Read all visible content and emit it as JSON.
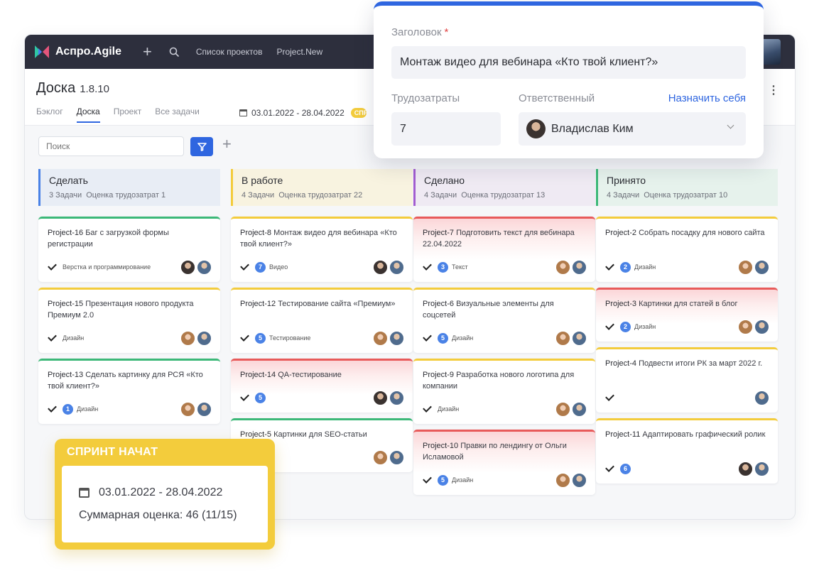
{
  "app": {
    "logo": "Аспро.Agile",
    "nav": [
      "Список проектов",
      "Project.New"
    ]
  },
  "header": {
    "title": "Доска",
    "version": "1.8.10",
    "tabs": [
      "Бэклог",
      "Доска",
      "Проект",
      "Все задачи"
    ],
    "active_tab": "Доска",
    "date_range": "03.01.2022 - 28.04.2022",
    "sprint_chip": "СПРИНТ НАЧАТ"
  },
  "toolbar": {
    "search_placeholder": "Поиск"
  },
  "columns": [
    {
      "title": "Сделать",
      "count": "3 Задачи",
      "estimate": "Оценка трудозатрат 1",
      "color": "#4a82e6",
      "bg": "#e8edf5",
      "cards": [
        {
          "id": "Project-16",
          "title": "Баг с загрузкой формы регистрации",
          "estimate": "",
          "tag": "Верстка и программирование",
          "accent": "#3cb878",
          "urgent": false,
          "avatars": [
            "man1",
            "man2"
          ]
        },
        {
          "id": "Project-15",
          "title": "Презентация нового продукта Премиум 2.0",
          "estimate": "",
          "tag": "Дизайн",
          "accent": "#f3cc3c",
          "urgent": false,
          "avatars": [
            "woman",
            "man2"
          ]
        },
        {
          "id": "Project-13",
          "title": "Сделать картинку для РСЯ «Кто твой клиент?»",
          "estimate": "1",
          "tag": "Дизайн",
          "accent": "#3cb878",
          "urgent": false,
          "avatars": [
            "woman",
            "man2"
          ]
        }
      ]
    },
    {
      "title": "В работе",
      "count": "4 Задачи",
      "estimate": "Оценка трудозатрат 22",
      "color": "#f3cc3c",
      "bg": "#f8f3e0",
      "cards": [
        {
          "id": "Project-8",
          "title": "Монтаж видео для вебинара «Кто твой клиент?»",
          "estimate": "7",
          "tag": "Видео",
          "accent": "#f3cc3c",
          "urgent": false,
          "avatars": [
            "man1",
            "man2"
          ]
        },
        {
          "id": "Project-12",
          "title": "Тестирование сайта «Премиум»",
          "estimate": "5",
          "tag": "Тестирование",
          "accent": "#f3cc3c",
          "urgent": false,
          "avatars": [
            "woman",
            "man2"
          ]
        },
        {
          "id": "Project-14",
          "title": "QA-тестирование",
          "estimate": "5",
          "tag": "",
          "accent": "#e85a5a",
          "urgent": true,
          "avatars": [
            "man1",
            "man2"
          ]
        },
        {
          "id": "Project-5",
          "title": "Картинки для SEO-статьи",
          "estimate": "",
          "tag": "",
          "accent": "#3cb878",
          "urgent": false,
          "avatars": [
            "woman",
            "man2"
          ]
        }
      ]
    },
    {
      "title": "Сделано",
      "count": "4 Задачи",
      "estimate": "Оценка трудозатрат 13",
      "color": "#a25dd0",
      "bg": "#efeaf3",
      "cards": [
        {
          "id": "Project-7",
          "title": "Подготовить текст для вебинара 22.04.2022",
          "estimate": "3",
          "tag": "Текст",
          "accent": "#e85a5a",
          "urgent": true,
          "avatars": [
            "woman",
            "man2"
          ]
        },
        {
          "id": "Project-6",
          "title": "Визуальные элементы для соцсетей",
          "estimate": "5",
          "tag": "Дизайн",
          "accent": "#f3cc3c",
          "urgent": false,
          "avatars": [
            "woman",
            "man2"
          ]
        },
        {
          "id": "Project-9",
          "title": "Разработка нового логотипа для компании",
          "estimate": "",
          "tag": "Дизайн",
          "accent": "#f3cc3c",
          "urgent": false,
          "avatars": [
            "woman",
            "man2"
          ]
        },
        {
          "id": "Project-10",
          "title": "Правки по лендингу от Ольги Исламовой",
          "estimate": "5",
          "tag": "Дизайн",
          "accent": "#e85a5a",
          "urgent": true,
          "avatars": [
            "woman",
            "man2"
          ]
        }
      ]
    },
    {
      "title": "Принято",
      "count": "4 Задачи",
      "estimate": "Оценка трудозатрат 10",
      "color": "#3cb878",
      "bg": "#e6f2ec",
      "cards": [
        {
          "id": "Project-2",
          "title": "Собрать посадку для нового сайта",
          "estimate": "2",
          "tag": "Дизайн",
          "accent": "#f3cc3c",
          "urgent": false,
          "avatars": [
            "woman",
            "man2"
          ]
        },
        {
          "id": "Project-3",
          "title": "Картинки для статей в блог",
          "estimate": "2",
          "tag": "Дизайн",
          "accent": "#e85a5a",
          "urgent": true,
          "avatars": [
            "woman",
            "man2"
          ]
        },
        {
          "id": "Project-4",
          "title": "Подвести итоги РК за март 2022 г.",
          "estimate": "",
          "tag": "",
          "accent": "#f3cc3c",
          "urgent": false,
          "avatars": [
            "man2"
          ]
        },
        {
          "id": "Project-11",
          "title": "Адаптировать графический ролик",
          "estimate": "6",
          "tag": "",
          "accent": "#f3cc3c",
          "urgent": false,
          "avatars": [
            "man1",
            "man2"
          ]
        }
      ]
    }
  ],
  "modal": {
    "title_label": "Заголовок",
    "required_mark": "*",
    "title_value": "Монтаж видео для вебинара «Кто твой клиент?»",
    "effort_label": "Трудозатраты",
    "effort_value": "7",
    "assignee_label": "Ответственный",
    "assign_self": "Назначить себя",
    "assignee_value": "Владислав Ким"
  },
  "sprint_popup": {
    "title": "СПРИНТ НАЧАТ",
    "dates": "03.01.2022 - 28.04.2022",
    "summary": "Суммарная оценка: 46 (11/15)"
  }
}
